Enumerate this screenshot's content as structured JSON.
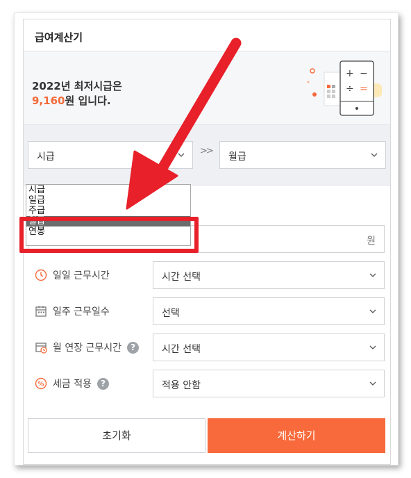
{
  "header": {
    "title": "급여계산기"
  },
  "banner": {
    "line1": "2022년 최저시급은",
    "wage": "9,160",
    "line2_suffix": "원 입니다."
  },
  "converter": {
    "from_value": "시급",
    "arrows": ">>",
    "to_value": "월급",
    "dropdown_options": [
      "시급",
      "일급",
      "주급",
      "월급",
      "연봉"
    ],
    "dropdown_selected": "월급"
  },
  "form": {
    "amount_unit": "원",
    "work_hours_label": "일일 근무시간",
    "work_hours_value": "시간 선택",
    "work_days_label": "일주 근무일수",
    "work_days_value": "선택",
    "overtime_label": "월 연장 근무시간",
    "overtime_value": "시간 선택",
    "tax_label": "세금 적용",
    "tax_value": "적용 안함",
    "help_glyph": "?"
  },
  "buttons": {
    "reset": "초기화",
    "calculate": "계산하기"
  },
  "colors": {
    "accent": "#f86a3b",
    "highlight": "#e8202a"
  },
  "icons": {
    "clock": "clock-icon",
    "calendar": "calendar-icon",
    "overtime": "overtime-calendar-icon",
    "percent": "percent-icon",
    "chevron": "chevron-down-icon"
  }
}
